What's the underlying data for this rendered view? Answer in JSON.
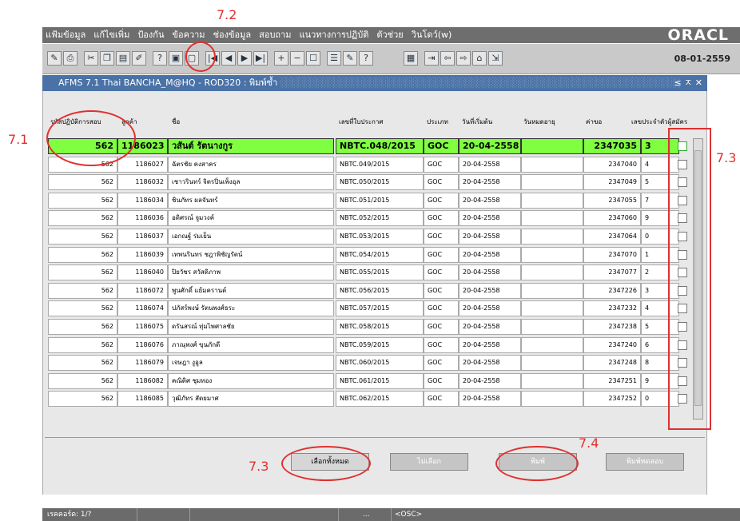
{
  "menu": [
    "แฟ้มข้อมูล",
    "แก้ไขเพิ่ม",
    "ป้องกัน",
    "ข้อความ",
    "ช่องข้อมูล",
    "สอบถาม",
    "แนวทางการปฏิบัติ",
    "ตัวช่วย",
    "วินโดว์(w)"
  ],
  "brand": "ORACL",
  "date": "08-01-2559",
  "window_title": "AFMS 7.1 Thai BANCHA_M@HQ - ROD320 : พิมพ์ซ้ำ",
  "window_controls": "≤ ㅈ ✕",
  "headers": {
    "exam_code": "รหัสปฏิบัติการสอบ",
    "customer": "ลูกค้า",
    "name": "ชื่อ",
    "cert_no": "เลขที่ใบประกาศ",
    "type": "ประเภท",
    "start_date": "วันที่เริ่มต้น",
    "expire_date": "วันหมดอายุ",
    "fee": "ค่าขอ",
    "applicant_no": "เลขประจำตัวผู้สมัคร"
  },
  "rows": [
    {
      "code": "562",
      "cust": "1186023",
      "name": "วสันต์ รัตนางกูร",
      "cert": "NBTC.048/2015",
      "type": "GOC",
      "start": "20-04-2558",
      "expire": "",
      "fee": "2347035",
      "app": "3"
    },
    {
      "code": "562",
      "cust": "1186027",
      "name": "ฉัตรชัย คงสาคร",
      "cert": "NBTC.049/2015",
      "type": "GOC",
      "start": "20-04-2558",
      "expire": "",
      "fee": "2347040",
      "app": "4"
    },
    {
      "code": "562",
      "cust": "1186032",
      "name": "เชาวรินทร์ จิตรปิ่นเพ็งอุล",
      "cert": "NBTC.050/2015",
      "type": "GOC",
      "start": "20-04-2558",
      "expire": "",
      "fee": "2347049",
      "app": "5"
    },
    {
      "code": "562",
      "cust": "1186034",
      "name": "ชินภัทร ผลจันทร์",
      "cert": "NBTC.051/2015",
      "type": "GOC",
      "start": "20-04-2558",
      "expire": "",
      "fee": "2347055",
      "app": "7"
    },
    {
      "code": "562",
      "cust": "1186036",
      "name": "อดิศรณ์ จูมวงค์",
      "cert": "NBTC.052/2015",
      "type": "GOC",
      "start": "20-04-2558",
      "expire": "",
      "fee": "2347060",
      "app": "9"
    },
    {
      "code": "562",
      "cust": "1186037",
      "name": "เอกณฐ์ ร่มเย็น",
      "cert": "NBTC.053/2015",
      "type": "GOC",
      "start": "20-04-2558",
      "expire": "",
      "fee": "2347064",
      "app": "0"
    },
    {
      "code": "562",
      "cust": "1186039",
      "name": "เทพนรินทร ชฎาพิชัญรัตน์",
      "cert": "NBTC.054/2015",
      "type": "GOC",
      "start": "20-04-2558",
      "expire": "",
      "fee": "2347070",
      "app": "1"
    },
    {
      "code": "562",
      "cust": "1186040",
      "name": "ปิยวัชร สวัสดิภาพ",
      "cert": "NBTC.055/2015",
      "type": "GOC",
      "start": "20-04-2558",
      "expire": "",
      "fee": "2347077",
      "app": "2"
    },
    {
      "code": "562",
      "cust": "1186072",
      "name": "พูนศักดิ์ แย้มครานต์",
      "cert": "NBTC.056/2015",
      "type": "GOC",
      "start": "20-04-2558",
      "expire": "",
      "fee": "2347226",
      "app": "3"
    },
    {
      "code": "562",
      "cust": "1186074",
      "name": "ปภัสร์พงษ์ รัตนพงศ์ธระ",
      "cert": "NBTC.057/2015",
      "type": "GOC",
      "start": "20-04-2558",
      "expire": "",
      "fee": "2347232",
      "app": "4"
    },
    {
      "code": "562",
      "cust": "1186075",
      "name": "ดรันสรณ์ ทุ่มไพศาลชัย",
      "cert": "NBTC.058/2015",
      "type": "GOC",
      "start": "20-04-2558",
      "expire": "",
      "fee": "2347238",
      "app": "5"
    },
    {
      "code": "562",
      "cust": "1186076",
      "name": "ภาณุพงศ์ ขุนภักดี",
      "cert": "NBTC.059/2015",
      "type": "GOC",
      "start": "20-04-2558",
      "expire": "",
      "fee": "2347240",
      "app": "6"
    },
    {
      "code": "562",
      "cust": "1186079",
      "name": "เจษฎา งูอูล",
      "cert": "NBTC.060/2015",
      "type": "GOC",
      "start": "20-04-2558",
      "expire": "",
      "fee": "2347248",
      "app": "8"
    },
    {
      "code": "562",
      "cust": "1186082",
      "name": "คณิติศ ชุมทอง",
      "cert": "NBTC.061/2015",
      "type": "GOC",
      "start": "20-04-2558",
      "expire": "",
      "fee": "2347251",
      "app": "9"
    },
    {
      "code": "562",
      "cust": "1186085",
      "name": "วุฒิภัทร สัตยมาศ",
      "cert": "NBTC.062/2015",
      "type": "GOC",
      "start": "20-04-2558",
      "expire": "",
      "fee": "2347252",
      "app": "0"
    }
  ],
  "buttons": {
    "select_all": "เลือกทั้งหมด",
    "deselect": "ไม่เลือก",
    "print": "พิมพ์",
    "test_print": "พิมพ์ทดลอบ"
  },
  "status": {
    "record": "เรคคอร์ด: 1/?",
    "dots": "...",
    "osc": "<OSC>"
  },
  "annotations": {
    "a71": "7.1",
    "a72": "7.2",
    "a73": "7.3",
    "a74": "7.4",
    "a73b": "7.3",
    "color": "#e03030"
  }
}
